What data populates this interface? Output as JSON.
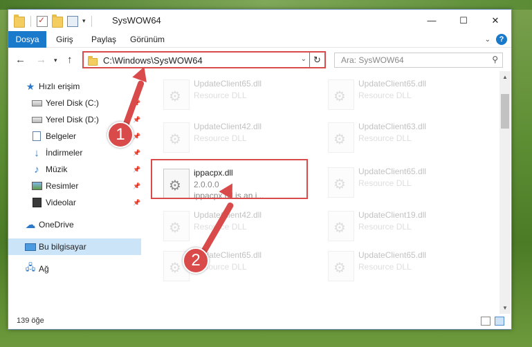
{
  "window": {
    "title": "SysWOW64",
    "minimize": "—",
    "maximize": "☐",
    "close": "✕"
  },
  "ribbon": {
    "tabs": [
      "Dosya",
      "Giriş",
      "Paylaş",
      "Görünüm"
    ]
  },
  "address": {
    "path": "C:\\Windows\\SysWOW64",
    "search_placeholder": "Ara: SysWOW64"
  },
  "nav": {
    "quick_access": "Hızlı erişim",
    "items": [
      {
        "label": "Yerel Disk (C:)",
        "icon": "drive-icon"
      },
      {
        "label": "Yerel Disk (D:)",
        "icon": "drive-icon"
      },
      {
        "label": "Belgeler",
        "icon": "documents-icon"
      },
      {
        "label": "İndirmeler",
        "icon": "downloads-icon"
      },
      {
        "label": "Müzik",
        "icon": "music-icon"
      },
      {
        "label": "Resimler",
        "icon": "pictures-icon"
      },
      {
        "label": "Videolar",
        "icon": "videos-icon"
      }
    ],
    "onedrive": "OneDrive",
    "this_pc": "Bu bilgisayar",
    "network": "Ağ"
  },
  "files": {
    "left": [
      {
        "name": "UpdateClient65.dll",
        "sub": "Resource DLL"
      },
      {
        "name": "UpdateClient42.dll",
        "sub": "Resource DLL"
      },
      {
        "name": "ippacpx.dll",
        "sub": "2.0.0.0",
        "desc": "ippacpx.dll is an i..."
      },
      {
        "name": "UpdateClient42.dll",
        "sub": "Resource DLL"
      },
      {
        "name": "UpdateClient65.dll",
        "sub": "Resource DLL"
      }
    ],
    "right": [
      {
        "name": "UpdateClient65.dll",
        "sub": "Resource DLL"
      },
      {
        "name": "UpdateClient63.dll",
        "sub": "Resource DLL"
      },
      {
        "name": "UpdateClient65.dll",
        "sub": "Resource DLL"
      },
      {
        "name": "UpdateClient19.dll",
        "sub": "Resource DLL"
      },
      {
        "name": "UpdateClient65.dll",
        "sub": "Resource DLL"
      }
    ]
  },
  "status": {
    "count": "139 öğe"
  },
  "annotations": {
    "step1": "1",
    "step2": "2",
    "color": "#d94a4a"
  }
}
